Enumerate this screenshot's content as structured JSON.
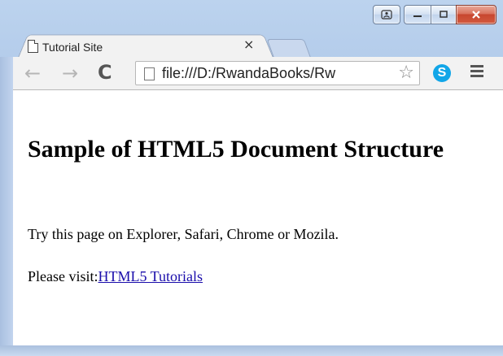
{
  "window": {
    "tab_title": "Tutorial Site",
    "tab_close": "×"
  },
  "toolbar": {
    "back_icon": "←",
    "forward_icon": "→",
    "reload_icon": "C",
    "address": "file:///D:/RwandaBooks/Rw",
    "star_icon": "☆",
    "skype_icon": "S",
    "menu_icon": "hamburger-menu-icon"
  },
  "page": {
    "heading": "Sample of HTML5 Document Structure",
    "paragraph1": "Try this page on Explorer, Safari, Chrome or Mozila.",
    "paragraph2_prefix": "Please visit:",
    "paragraph2_link": "HTML5 Tutorials"
  },
  "colors": {
    "link": "#1a0dab",
    "window_frame": "#bcd3ee",
    "close_button": "#c7462f"
  }
}
